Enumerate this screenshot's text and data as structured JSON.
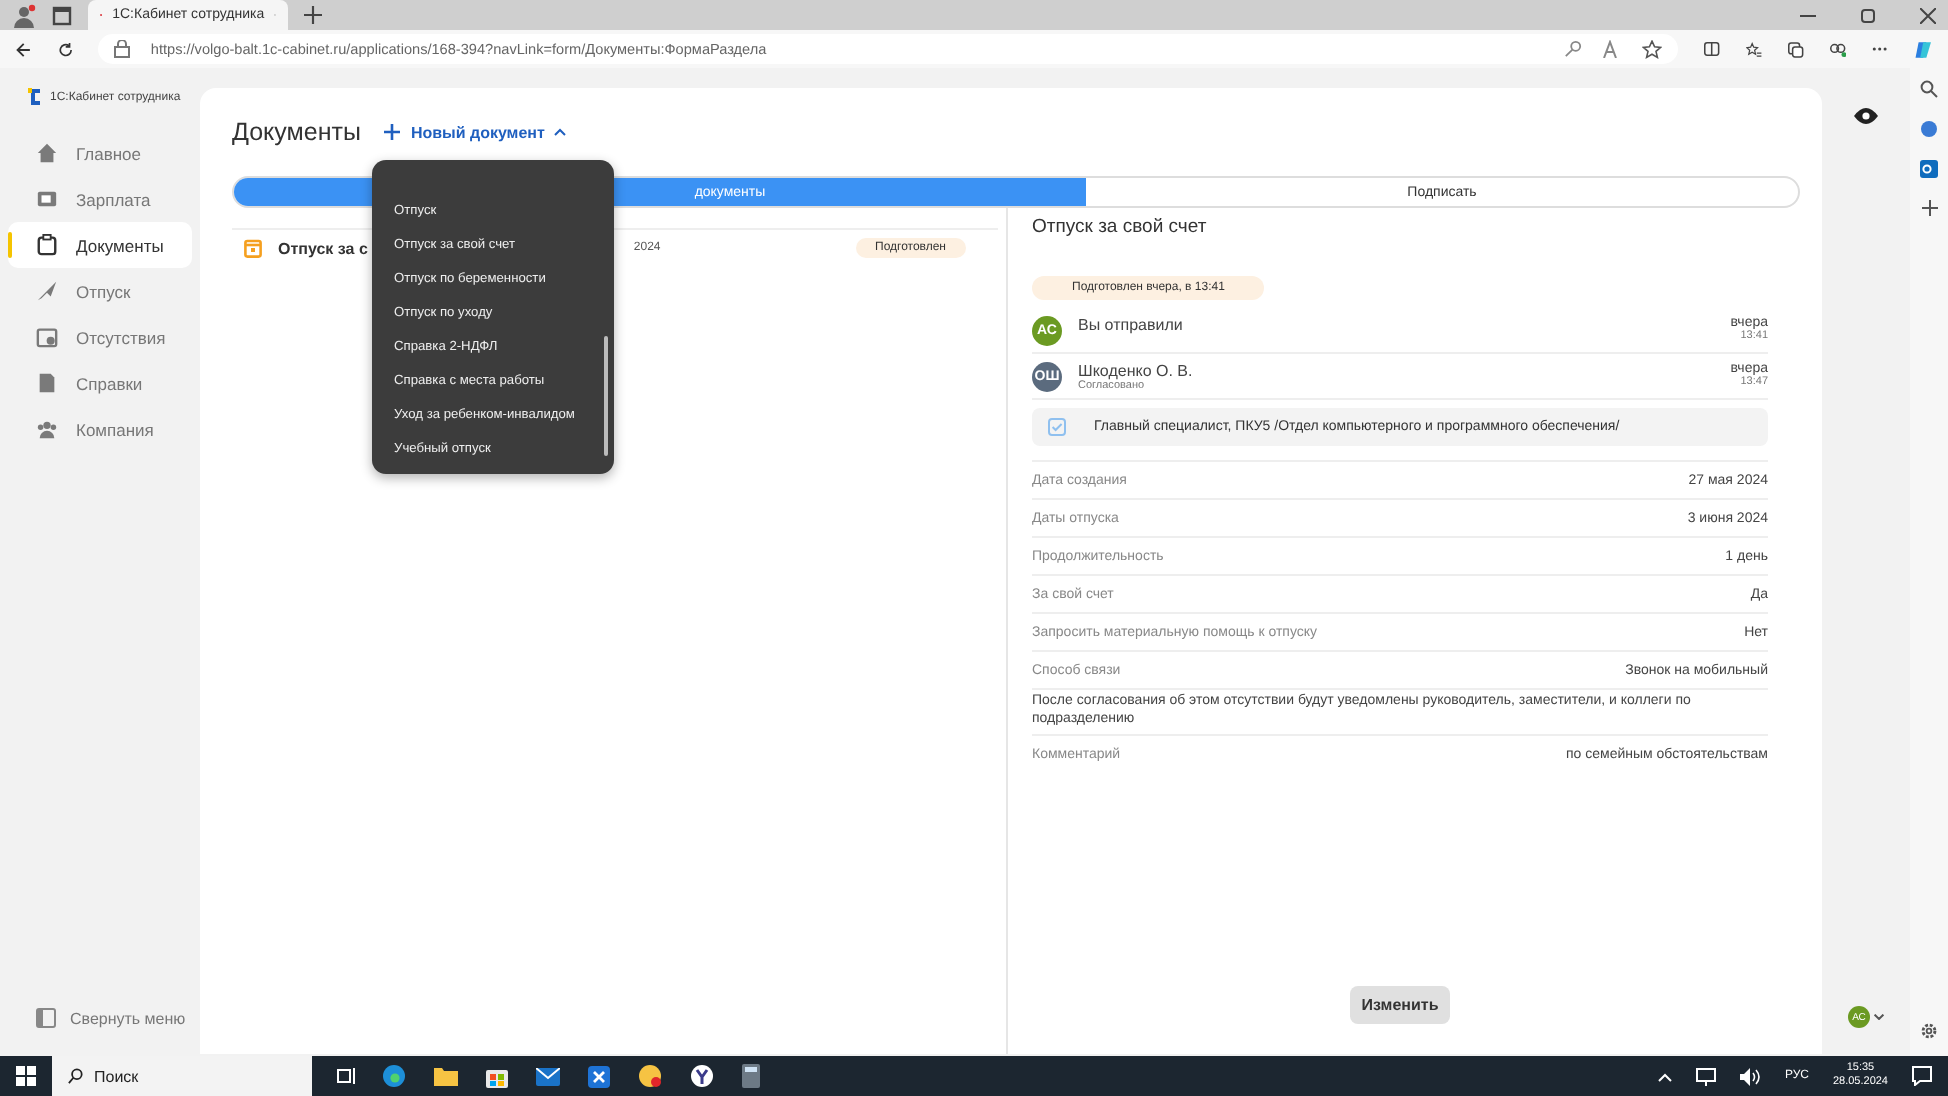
{
  "browser": {
    "tab_title": "1С:Кабинет сотрудника",
    "url": "https://volgo-balt.1c-cabinet.ru/applications/168-394?navLink=form/Документы:ФормаРаздела"
  },
  "sidebar": {
    "logo": "1С:Кабинет сотрудника",
    "items": [
      {
        "label": "Главное",
        "kind": "home",
        "selected": false
      },
      {
        "label": "Зарплата",
        "kind": "wallet",
        "selected": false
      },
      {
        "label": "Документы",
        "kind": "docs",
        "selected": true
      },
      {
        "label": "Отпуск",
        "kind": "plane",
        "selected": false
      },
      {
        "label": "Отсутствия",
        "kind": "calendar",
        "selected": false
      },
      {
        "label": "Справки",
        "kind": "file",
        "selected": false
      },
      {
        "label": "Компания",
        "kind": "people",
        "selected": false
      }
    ],
    "collapse": "Свернуть меню"
  },
  "page": {
    "title": "Документы",
    "new_button": "Новый документ",
    "tabs": [
      {
        "label": "документы",
        "selected": true
      },
      {
        "label": "Подписать",
        "selected": false
      }
    ],
    "list": [
      {
        "title": "Отпуск за с",
        "date": "2024",
        "status": "Подготовлен"
      }
    ]
  },
  "menu": {
    "items": [
      "Отпуск",
      "Отпуск за свой счет",
      "Отпуск по беременности",
      "Отпуск по уходу",
      "Справка 2-НДФЛ",
      "Справка с места работы",
      "Уход за ребенком-инвалидом",
      "Учебный отпуск"
    ]
  },
  "detail": {
    "title": "Отпуск за свой счет",
    "status": "Подготовлен вчера, в 13:41",
    "events": [
      {
        "initials": "АС",
        "color": "#6b9a22",
        "name": "Вы отправили",
        "day": "вчера",
        "time": "13:41"
      },
      {
        "initials": "ОШ",
        "color": "#5b6b7e",
        "name": "Шкоденко О. В.",
        "note": "Согласовано",
        "day": "вчера",
        "time": "13:47"
      }
    ],
    "position": "Главный специалист, ПКУ5 /Отдел компьютерного и программного обеспечения/",
    "fields": [
      {
        "kind": "pair",
        "label": "Дата создания",
        "value": "27 мая 2024"
      },
      {
        "kind": "pair",
        "label": "Даты отпуска",
        "value": "3 июня 2024"
      },
      {
        "kind": "pair",
        "label": "Продолжительность",
        "value": "1 день"
      },
      {
        "kind": "pair",
        "label": "За свой счет",
        "value": "Да"
      },
      {
        "kind": "pair",
        "label": "Запросить материальную помощь к отпуску",
        "value": "Нет"
      },
      {
        "kind": "pair",
        "label": "Способ связи",
        "value": "Звонок на мобильный"
      },
      {
        "kind": "note",
        "label": "После согласования об этом отсутствии будут уведомлены руководитель, заместители, и коллеги по подразделению"
      },
      {
        "kind": "pair",
        "label": "Комментарий",
        "value": "по семейным обстоятельствам"
      }
    ],
    "edit_button": "Изменить"
  },
  "user": {
    "initials": "АС"
  },
  "taskbar": {
    "search": "Поиск",
    "lang": "РУС",
    "time": "15:35",
    "date": "28.05.2024"
  }
}
